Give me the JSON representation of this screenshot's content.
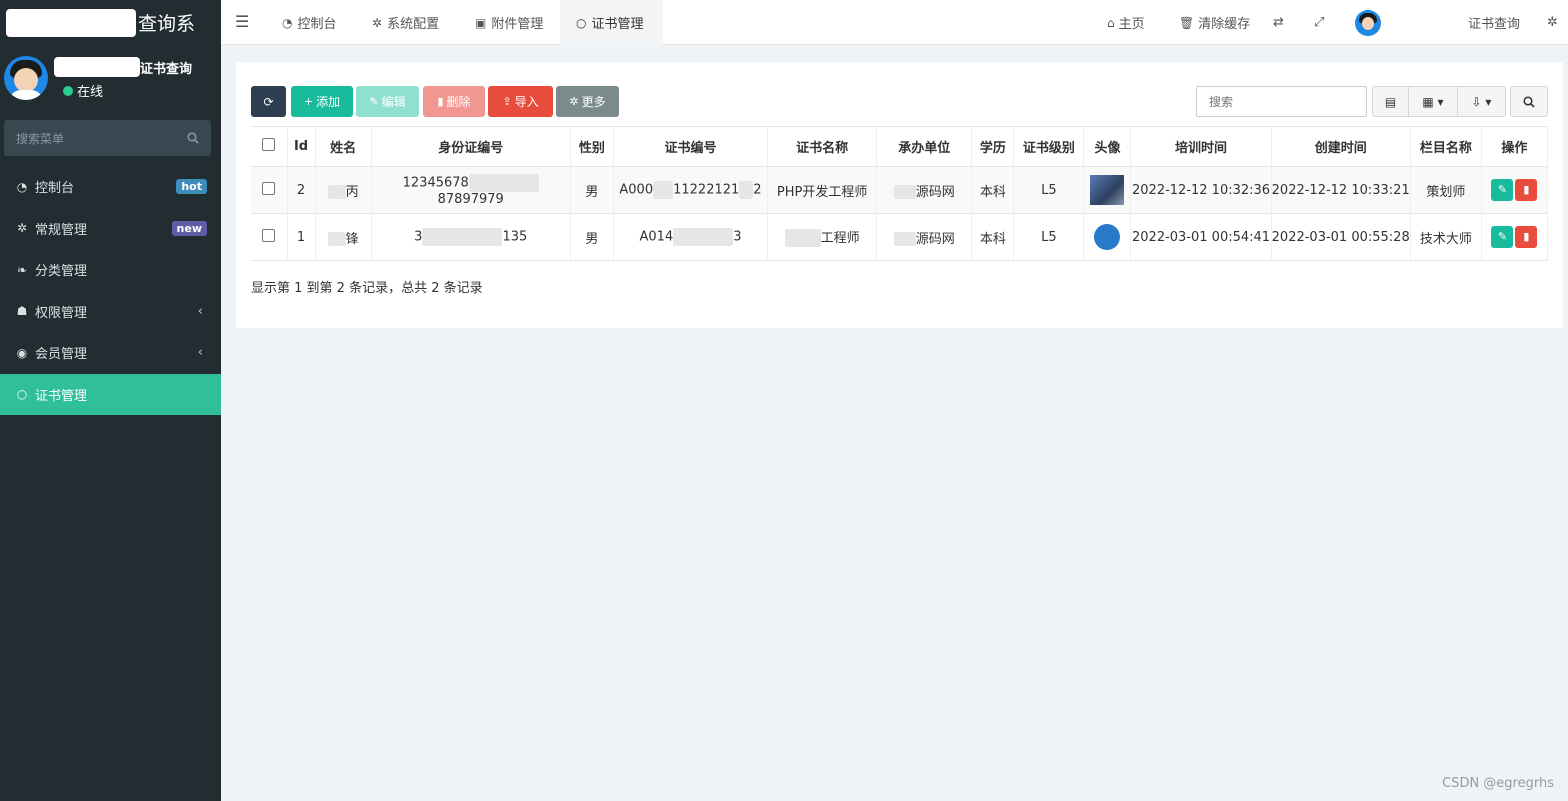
{
  "sidebar": {
    "logo_text": "查询系",
    "user_name": "证书查询",
    "status": "在线",
    "search_placeholder": "搜索菜单",
    "items": [
      {
        "label": "控制台",
        "icon": "dashboard-icon",
        "badge": "hot"
      },
      {
        "label": "常规管理",
        "icon": "cogs-icon",
        "badge": "new"
      },
      {
        "label": "分类管理",
        "icon": "leaf-icon"
      },
      {
        "label": "权限管理",
        "icon": "group-icon"
      },
      {
        "label": "会员管理",
        "icon": "user-circle-icon"
      },
      {
        "label": "证书管理",
        "icon": "circle-icon",
        "active": true
      }
    ]
  },
  "header": {
    "tabs": [
      {
        "label": "控制台",
        "icon": "dashboard-icon"
      },
      {
        "label": "系统配置",
        "icon": "gear-icon"
      },
      {
        "label": "附件管理",
        "icon": "image-icon"
      },
      {
        "label": "证书管理",
        "icon": "circle-icon",
        "active": true
      }
    ],
    "home_label": "主页",
    "clear_cache_label": "清除缓存",
    "user_label": "证书查询"
  },
  "toolbar": {
    "add": "添加",
    "edit": "编辑",
    "delete": "删除",
    "import": "导入",
    "more": "更多",
    "search_placeholder": "搜索"
  },
  "table": {
    "columns": [
      "Id",
      "姓名",
      "身份证编号",
      "性别",
      "证书编号",
      "证书名称",
      "承办单位",
      "学历",
      "证书级别",
      "头像",
      "培训时间",
      "创建时间",
      "栏目名称",
      "操作"
    ],
    "rows": [
      {
        "id": "2",
        "name": "丙",
        "idcard_start": "12345678",
        "idcard_end": "87897979",
        "gender": "男",
        "cert_start": "A000",
        "cert_mid": "11222121",
        "cert_end": "2",
        "cert_name": "PHP开发工程师",
        "org": "源码网",
        "edu": "本科",
        "level": "L5",
        "train_time": "2022-12-12 10:32:36",
        "create_time": "2022-12-12 10:33:21",
        "column": "策划师"
      },
      {
        "id": "1",
        "name": "锋",
        "idcard_start": "3",
        "idcard_end": "135",
        "gender": "男",
        "cert_start": "A014",
        "cert_mid": "",
        "cert_end": "3",
        "cert_name": "工程师",
        "org": "源码网",
        "edu": "本科",
        "level": "L5",
        "train_time": "2022-03-01 00:54:41",
        "create_time": "2022-03-01 00:55:28",
        "column": "技术大师"
      }
    ]
  },
  "pager_info": "显示第 1 到第 2 条记录，总共 2 条记录",
  "watermark": "CSDN @egregrhs",
  "colors": {
    "sidebar_bg": "#222d32",
    "accent": "#18bc9c",
    "active_menu": "#2fbf9b",
    "danger": "#e74c3c"
  }
}
